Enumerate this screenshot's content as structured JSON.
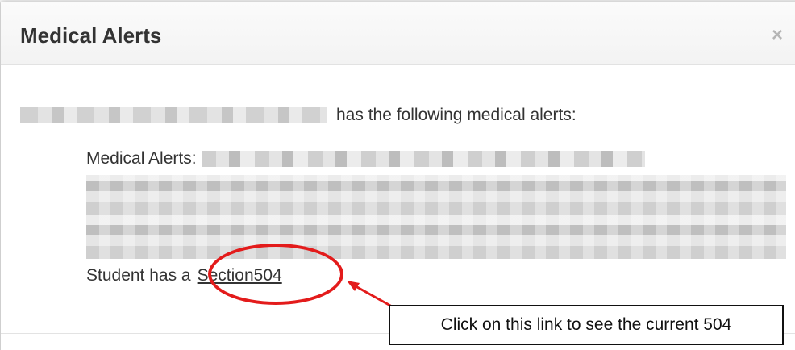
{
  "dialog": {
    "title": "Medical Alerts",
    "close_glyph": "×"
  },
  "content": {
    "intro_suffix": "has the following medical alerts:",
    "alerts_label": "Medical Alerts:",
    "student_prefix": "Student has a",
    "section_link": "Section504"
  },
  "annotation": {
    "callout_text": "Click on this link to see the current 504",
    "accent_color": "#e31b1b"
  },
  "icons": {
    "close": "close-icon"
  }
}
